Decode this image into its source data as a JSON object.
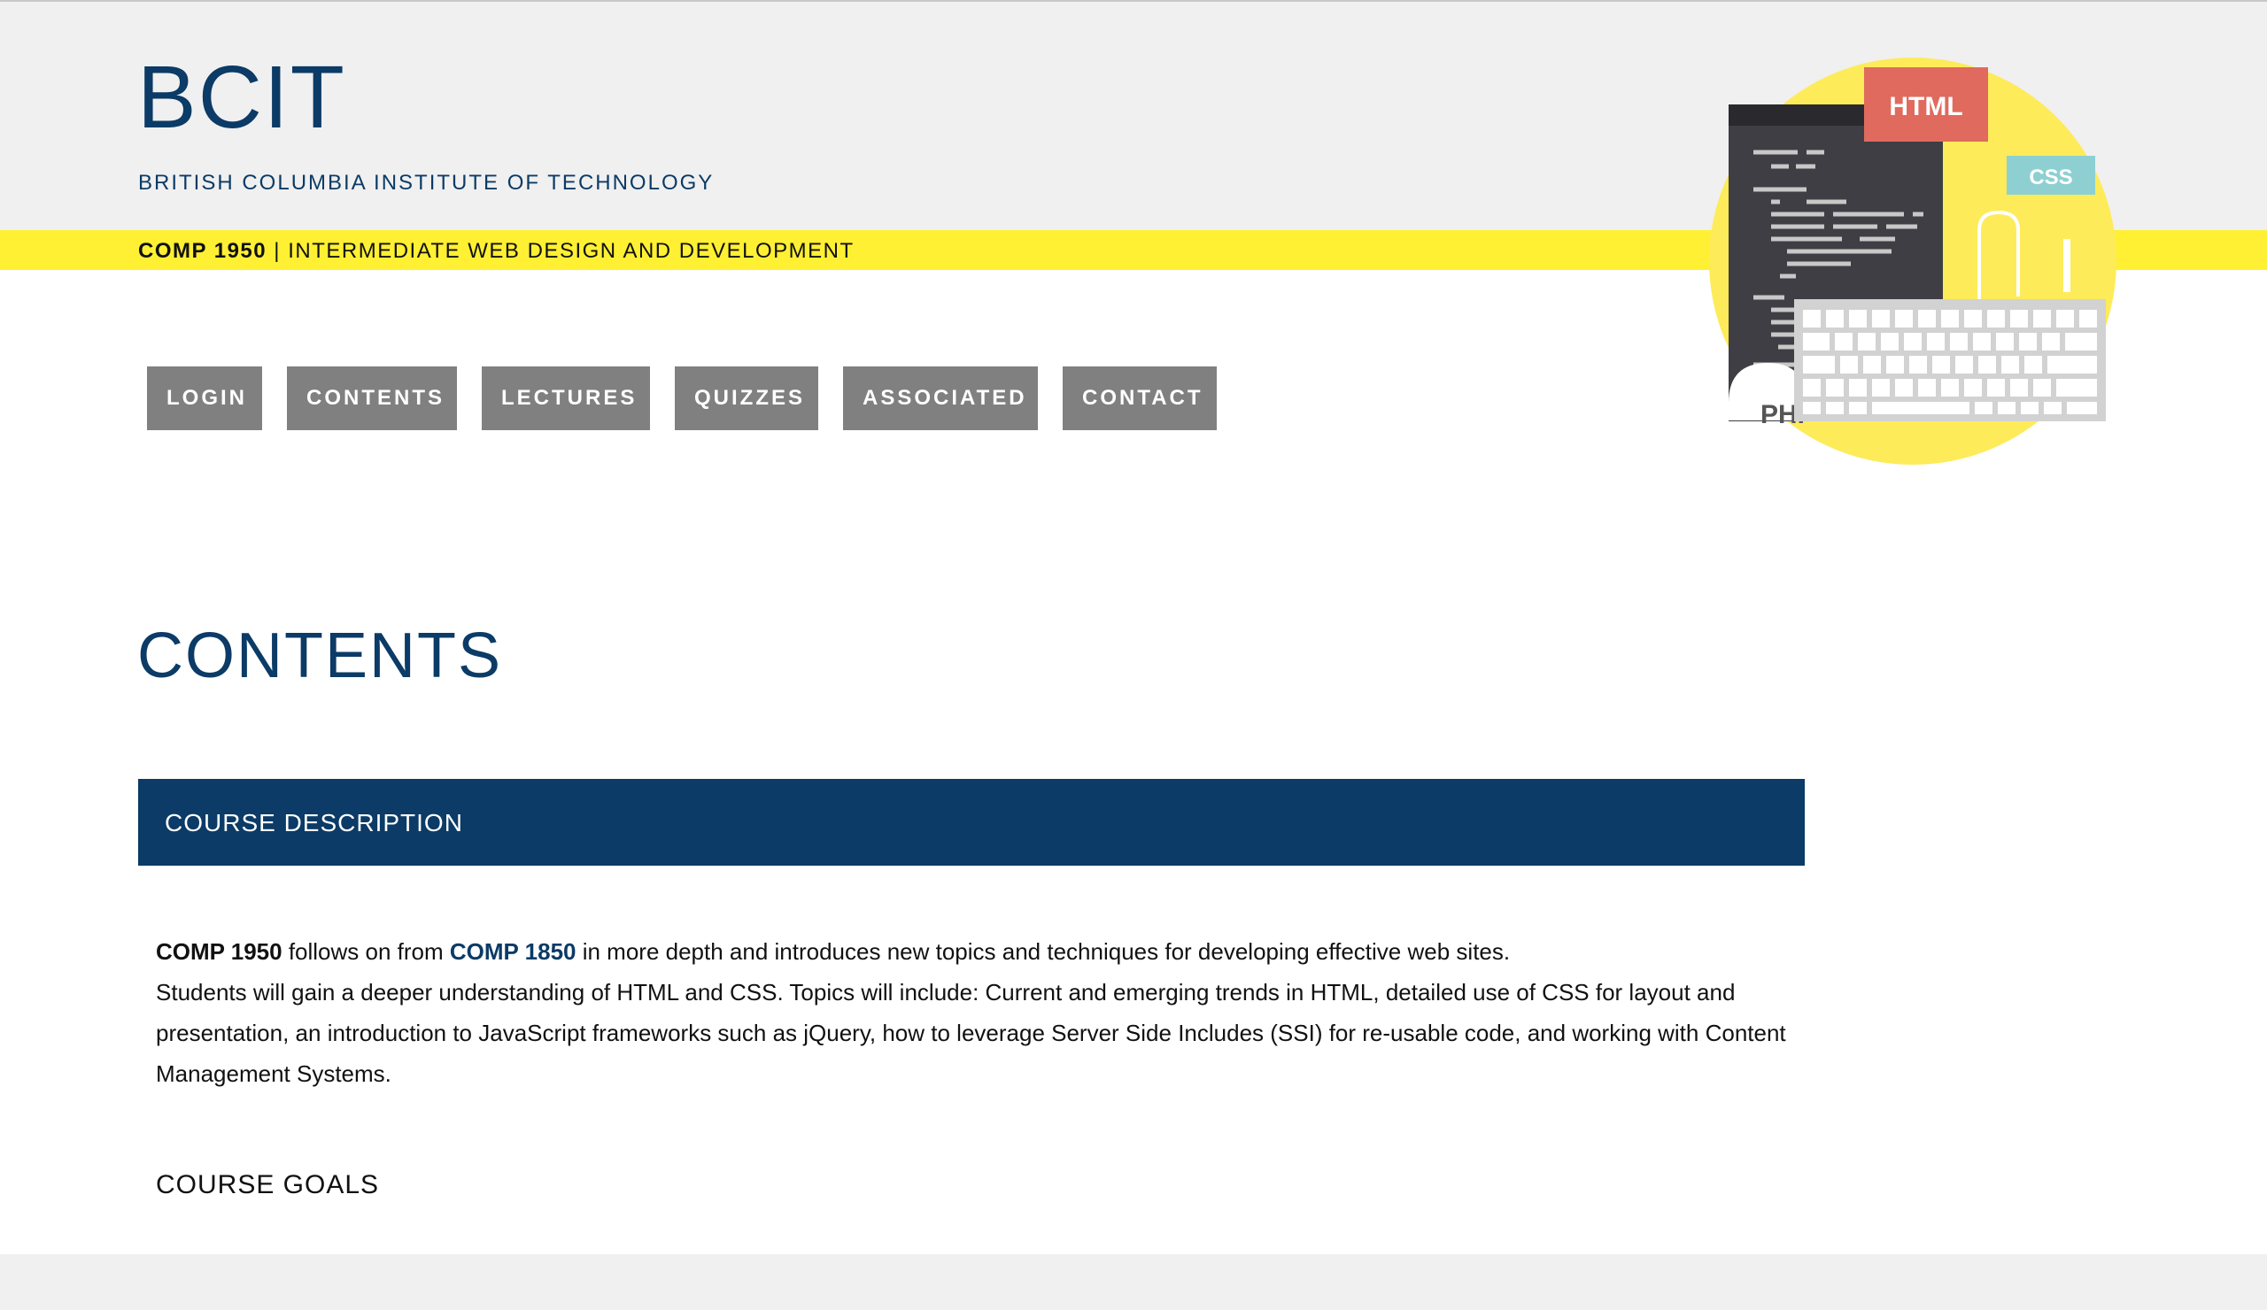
{
  "brand": {
    "logo": "BCIT",
    "subtitle": "BRITISH COLUMBIA INSTITUTE OF TECHNOLOGY",
    "course_code": "COMP 1950",
    "course_separator": " | ",
    "course_name": "INTERMEDIATE WEB DESIGN AND DEVELOPMENT"
  },
  "nav": {
    "items": [
      {
        "label": "LOGIN"
      },
      {
        "label": "CONTENTS"
      },
      {
        "label": "LECTURES"
      },
      {
        "label": "QUIZZES"
      },
      {
        "label": "ASSOCIATED"
      },
      {
        "label": "CONTACT"
      }
    ]
  },
  "illustration": {
    "html_tag": "HTML",
    "css_tag": "CSS",
    "php_tag": "PHP"
  },
  "main": {
    "title": "CONTENTS",
    "section_title": "COURSE DESCRIPTION",
    "desc_course": "COMP 1950",
    "desc_part1": " follows on from ",
    "desc_link": "COMP 1850",
    "desc_part2": " in more depth and introduces new topics and techniques for developing effective web sites.",
    "desc_para2": "Students will gain a deeper understanding of HTML and CSS. Topics will include: Current and emerging trends in HTML, detailed use of CSS for layout and presentation, an introduction to JavaScript frameworks such as jQuery, how to leverage Server Side Includes (SSI) for re-usable code, and working with Content Management Systems.",
    "goals_title": "COURSE GOALS"
  },
  "colors": {
    "brand_blue": "#0b3b66",
    "accent_yellow": "#fff033",
    "nav_gray": "#808080",
    "html_red": "#e06a5e",
    "css_teal": "#8ed0d2"
  }
}
